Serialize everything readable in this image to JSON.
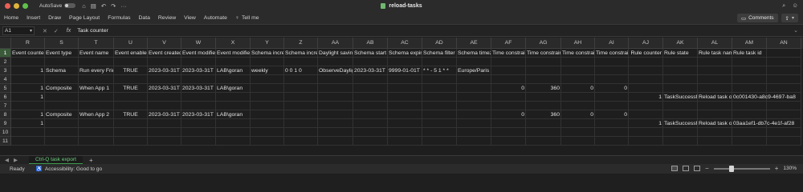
{
  "window": {
    "title": "reload-tasks",
    "autosave_label": "AutoSave",
    "autosave_state": "OFF"
  },
  "ribbon": {
    "tabs": [
      "Home",
      "Insert",
      "Draw",
      "Page Layout",
      "Formulas",
      "Data",
      "Review",
      "View",
      "Automate"
    ],
    "tell_me": "Tell me",
    "comments_label": "Comments",
    "share_label": "Share"
  },
  "formula_bar": {
    "name_box": "A1",
    "value": "Task counter"
  },
  "grid": {
    "columns": [
      "R",
      "S",
      "T",
      "U",
      "V",
      "W",
      "X",
      "Y",
      "Z",
      "AA",
      "AB",
      "AC",
      "AD",
      "AE",
      "AF",
      "AG",
      "AH",
      "AI",
      "AJ",
      "AK",
      "AL",
      "AM",
      "AN"
    ],
    "rows": [
      "1",
      "2",
      "3",
      "4",
      "5",
      "6",
      "7",
      "8",
      "9",
      "10",
      "11"
    ],
    "cells": {
      "1": {
        "R": "Event counter",
        "S": "Event type",
        "T": "Event name",
        "U": "Event enabled",
        "V": "Event created",
        "W": "Event modified",
        "X": "Event modified",
        "Y": "Schema increment",
        "Z": "Schema increment",
        "AA": "Daylight savings",
        "AB": "Schema start",
        "AC": "Schema expiry",
        "AD": "Schema filter",
        "AE": "Schema timezone",
        "AF": "Time constraint",
        "AG": "Time constraint",
        "AH": "Time constraint",
        "AI": "Time constraint",
        "AJ": "Rule counter",
        "AK": "Rule state",
        "AL": "Rule task name",
        "AM": "Rule task id"
      },
      "3": {
        "R": "1",
        "S": "Schema",
        "T": "Run every Friday",
        "U": "TRUE",
        "V": "2023-03-31T",
        "W": "2023-03-31T",
        "X": "LAB\\goran",
        "Y": "weekly",
        "Z": "0 0 1 0",
        "AA": "ObserveDaylight",
        "AB": "2023-03-31T",
        "AC": "9999-01-01T",
        "AD": "* * - 5 1 * *",
        "AE": "Europe/Paris"
      },
      "5": {
        "R": "1",
        "S": "Composite",
        "T": "When App 1",
        "U": "TRUE",
        "V": "2023-03-31T",
        "W": "2023-03-31T",
        "X": "LAB\\goran",
        "AF": "0",
        "AG": "360",
        "AH": "0",
        "AI": "0"
      },
      "6": {
        "R": "1",
        "AJ": "1",
        "AK": "TaskSuccessful",
        "AL": "Reload task of",
        "AM": "0c001430-a8c9-4697-ba8"
      },
      "8": {
        "R": "1",
        "S": "Composite",
        "T": "When App 2",
        "U": "TRUE",
        "V": "2023-03-31T",
        "W": "2023-03-31T",
        "X": "LAB\\goran",
        "AF": "0",
        "AG": "360",
        "AH": "0",
        "AI": "0"
      },
      "9": {
        "R": "1",
        "AJ": "1",
        "AK": "TaskSuccessful",
        "AL": "Reload task of",
        "AM": "03aa1ef1-db7c-4e1f-af28"
      }
    }
  },
  "sheet_tabs": {
    "active": "Ctrl-Q task export",
    "add_label": "+"
  },
  "status_bar": {
    "ready": "Ready",
    "accessibility": "Accessibility: Good to go",
    "zoom": "130%",
    "zoom_level_percent": 130
  },
  "colors": {
    "accent_green": "#3d9b4d",
    "background": "#1e1e1e"
  }
}
